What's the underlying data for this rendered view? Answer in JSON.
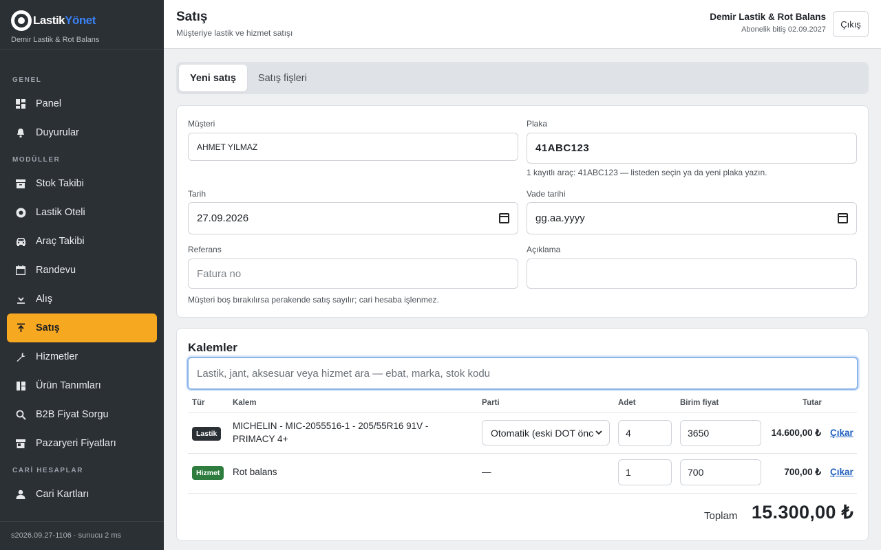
{
  "brand": {
    "logo_part1": "Lastik",
    "logo_part2": "Yönet",
    "subtitle": "Demir Lastik & Rot Balans"
  },
  "sidebar": {
    "sections": {
      "genel": "GENEL",
      "moduller": "MODÜLLER",
      "cari": "CARİ HESAPLAR"
    },
    "items": [
      {
        "label": "Panel",
        "icon": "dashboard-icon"
      },
      {
        "label": "Duyurular",
        "icon": "bell-icon"
      },
      {
        "label": "Stok Takibi",
        "icon": "archive-box-icon"
      },
      {
        "label": "Lastik Oteli",
        "icon": "tire-icon"
      },
      {
        "label": "Araç Takibi",
        "icon": "car-icon"
      },
      {
        "label": "Randevu",
        "icon": "calendar-icon"
      },
      {
        "label": "Alış",
        "icon": "download-icon"
      },
      {
        "label": "Satış",
        "icon": "upload-icon",
        "active": true
      },
      {
        "label": "Hizmetler",
        "icon": "wrench-icon"
      },
      {
        "label": "Ürün Tanımları",
        "icon": "list-icon"
      },
      {
        "label": "B2B Fiyat Sorgu",
        "icon": "search-icon"
      },
      {
        "label": "Pazaryeri Fiyatları",
        "icon": "store-icon"
      },
      {
        "label": "Cari Kartları",
        "icon": "person-icon"
      }
    ],
    "footer": "s2026.09.27-1106 · sunucu 2 ms"
  },
  "header": {
    "title": "Satış",
    "subtitle": "Müşteriye lastik ve hizmet satışı",
    "company": "Demir Lastik & Rot Balans",
    "subscription": "Abonelik bitiş 02.09.2027",
    "logout": "Çıkış"
  },
  "tabs": [
    "Yeni satış",
    "Satış fişleri"
  ],
  "form": {
    "customer_label": "Müşteri",
    "customer_value": "AHMET YILMAZ",
    "plate_label": "Plaka",
    "plate_value": "41ABC123",
    "plate_hint": "1 kayıtlı araç: 41ABC123 — listeden seçin ya da yeni plaka yazın.",
    "date_label": "Tarih",
    "date_value": "27.09.2026",
    "due_label": "Vade tarihi",
    "due_placeholder": "gg.aa.yyyy",
    "ref_label": "Referans",
    "ref_placeholder": "Fatura no",
    "desc_label": "Açıklama",
    "desc_value": "",
    "footer_hint": "Müşteri boş bırakılırsa perakende satış sayılır; cari hesaba işlenmez."
  },
  "items": {
    "title": "Kalemler",
    "search_placeholder": "Lastik, jant, aksesuar veya hizmet ara — ebat, marka, stok kodu",
    "columns": {
      "type": "Tür",
      "item": "Kalem",
      "batch": "Parti",
      "qty": "Adet",
      "unit_price": "Birim fiyat",
      "amount": "Tutar"
    },
    "rows": [
      {
        "type": "Lastik",
        "name": "MICHELIN - MIC-2055516-1 - 205/55R16 91V - PRIMACY 4+",
        "batch": "Otomatik (eski DOT önce",
        "qty": "4",
        "unit_price": "3650",
        "amount": "14.600,00 ₺",
        "remove": "Çıkar"
      },
      {
        "type": "Hizmet",
        "name": "Rot balans",
        "batch": "—",
        "qty": "1",
        "unit_price": "700",
        "amount": "700,00 ₺",
        "remove": "Çıkar"
      }
    ],
    "total_label": "Toplam",
    "total_value": "15.300,00 ₺"
  }
}
